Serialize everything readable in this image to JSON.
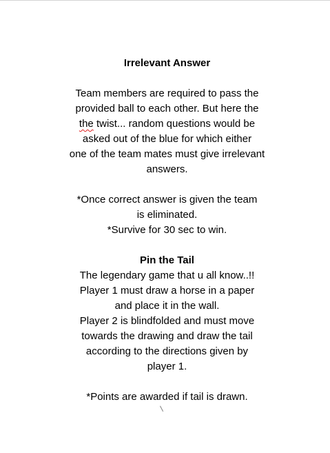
{
  "section1": {
    "title": "Irrelevant Answer",
    "body_lines": [
      "Team members are required to pass the",
      "provided ball to each other. But here the",
      "twist... random questions would be",
      "asked out of the blue for which either",
      "one of the team mates must give irrelevant",
      "answers."
    ],
    "flagged_word": "the",
    "rule_lines": [
      "*Once correct answer is given the team",
      "is eliminated.",
      "*Survive for 30 sec to win."
    ]
  },
  "section2": {
    "title": "Pin the Tail",
    "body_lines": [
      "The legendary game that u all know..!!",
      "Player 1 must draw a horse in a paper",
      "and place it in the wall.",
      "Player 2 is blindfolded and must move",
      "towards the drawing and draw the tail",
      "according to the directions given by",
      "player 1."
    ],
    "rule_lines": [
      "*Points are awarded if tail is drawn."
    ]
  }
}
